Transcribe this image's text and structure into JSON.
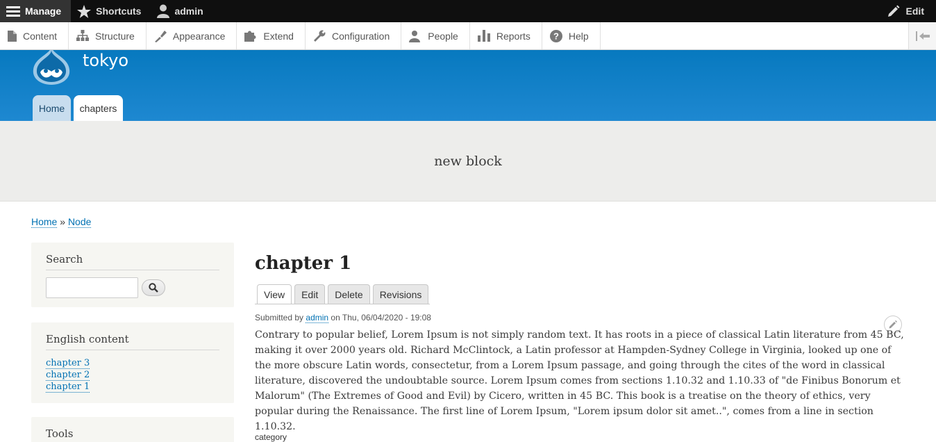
{
  "toolbar": {
    "manage": "Manage",
    "shortcuts": "Shortcuts",
    "user": "admin",
    "edit": "Edit"
  },
  "tray": {
    "items": [
      "Content",
      "Structure",
      "Appearance",
      "Extend",
      "Configuration",
      "People",
      "Reports",
      "Help"
    ]
  },
  "header": {
    "site_name": "tokyo",
    "tabs": [
      "Home",
      "chapters"
    ]
  },
  "featured": {
    "text": "new block"
  },
  "breadcrumb": {
    "items": [
      "Home",
      "Node"
    ],
    "separator": "»"
  },
  "sidebar": {
    "search_title": "Search",
    "english_title": "English content",
    "english_links": [
      "chapter 3",
      "chapter 2",
      "chapter 1"
    ],
    "tools_title": "Tools"
  },
  "node": {
    "title": "chapter 1",
    "tabs": [
      "View",
      "Edit",
      "Delete",
      "Revisions"
    ],
    "submitted_prefix": "Submitted by",
    "author": "admin",
    "submitted_suffix": "on Thu, 06/04/2020 - 19:08",
    "body": "Contrary to popular belief, Lorem Ipsum is not simply random text. It has roots in a piece of classical Latin literature from 45 BC, making it over 2000 years old. Richard McClintock, a Latin professor at Hampden-Sydney College in Virginia, looked up one of the more obscure Latin words, consectetur, from a Lorem Ipsum passage, and going through the cites of the word in classical literature, discovered the undoubtable source. Lorem Ipsum comes from sections 1.10.32 and 1.10.33 of \"de Finibus Bonorum et Malorum\" (The Extremes of Good and Evil) by Cicero, written in 45 BC. This book is a treatise on the theory of ethics, very popular during the Renaissance. The first line of Lorem Ipsum, \"Lorem ipsum dolor sit amet..\", comes from a line in section 1.10.32.",
    "field_label": "category"
  },
  "colors": {
    "header_blue": "#0779bf",
    "link": "#0071b3",
    "toolbar_bg": "#0f0f0f"
  }
}
